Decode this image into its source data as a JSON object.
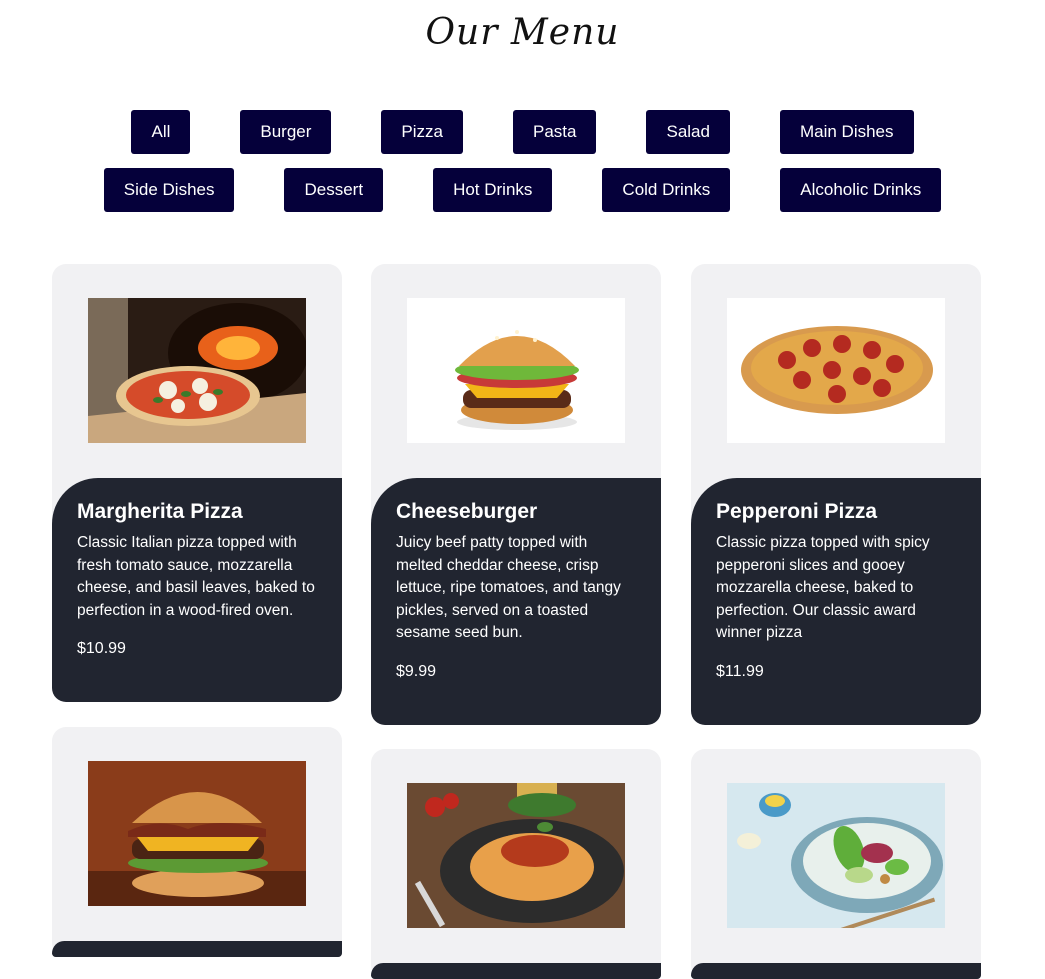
{
  "header": {
    "title": "Our Menu"
  },
  "filters": {
    "row1": [
      "All",
      "Burger",
      "Pizza",
      "Pasta",
      "Salad",
      "Main Dishes"
    ],
    "row2": [
      "Side Dishes",
      "Dessert",
      "Hot Drinks",
      "Cold Drinks",
      "Alcoholic Drinks"
    ]
  },
  "items": [
    {
      "name": "Margherita Pizza",
      "description": "Classic Italian pizza topped with fresh tomato sauce, mozzarella cheese, and basil leaves, baked to perfection in a wood-fired oven.",
      "price": "$10.99",
      "image": "margherita-pizza-photo"
    },
    {
      "name": "Cheeseburger",
      "description": "Juicy beef patty topped with melted cheddar cheese, crisp lettuce, ripe tomatoes, and tangy pickles, served on a toasted sesame seed bun.",
      "price": "$9.99",
      "image": "cheeseburger-photo"
    },
    {
      "name": "Pepperoni Pizza",
      "description": "Classic pizza topped with spicy pepperoni slices and gooey mozzarella cheese, baked to perfection. Our classic award winner pizza",
      "price": "$11.99",
      "image": "pepperoni-pizza-photo"
    },
    {
      "image": "bacon-burger-photo"
    },
    {
      "image": "spaghetti-bolognese-photo"
    },
    {
      "image": "green-salad-photo"
    }
  ],
  "colors": {
    "button_bg": "#05003a",
    "card_bg": "#f1f1f3",
    "card_body": "#212530"
  }
}
